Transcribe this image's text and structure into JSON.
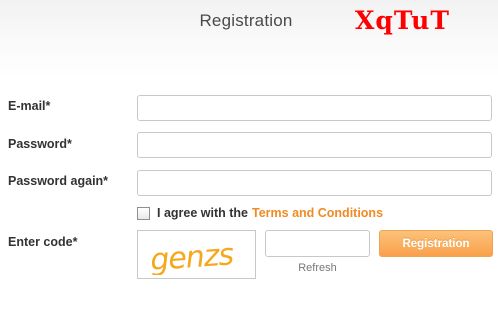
{
  "header": {
    "title": "Registration",
    "logo_text": "XqTuT"
  },
  "form": {
    "email": {
      "label": "E-mail*",
      "value": ""
    },
    "password": {
      "label": "Password*",
      "value": ""
    },
    "password_again": {
      "label": "Password again*",
      "value": ""
    },
    "agree": {
      "checked": false,
      "text": "I agree with the",
      "link_text": "Terms and Conditions"
    },
    "code": {
      "label": "Enter code*",
      "value": "",
      "captcha_text": "genzs",
      "refresh_label": "Refresh"
    },
    "submit_label": "Registration"
  },
  "colors": {
    "logo": "#ff0000",
    "link": "#f08a24",
    "button": "#f9a04b",
    "captcha": "#f5a81c"
  }
}
